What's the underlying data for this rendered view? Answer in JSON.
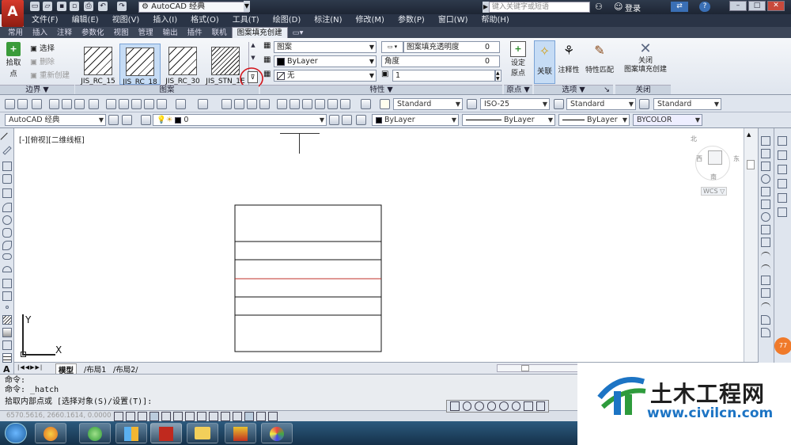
{
  "app": {
    "logo_letter": "A",
    "workspace": "AutoCAD 经典",
    "doc_title": "",
    "search_placeholder": "键入关键字或短语",
    "login": "登录"
  },
  "menubar": {
    "items": [
      "文件(F)",
      "编辑(E)",
      "视图(V)",
      "插入(I)",
      "格式(O)",
      "工具(T)",
      "绘图(D)",
      "标注(N)",
      "修改(M)",
      "参数(P)",
      "窗口(W)",
      "帮助(H)"
    ]
  },
  "ribbon_tabs": {
    "items": [
      "常用",
      "插入",
      "注释",
      "参数化",
      "视图",
      "管理",
      "输出",
      "插件",
      "联机",
      "图案填充创建"
    ],
    "active_index": 9
  },
  "ribbon": {
    "boundary": {
      "pick_label": "拾取点",
      "select_label": "选择",
      "remove_label": "删除",
      "recreate_label": "重新创建",
      "panel_title": "边界 ▼"
    },
    "pattern": {
      "items": [
        "JIS_RC_15",
        "JIS_RC_18",
        "JIS_RC_30",
        "JIS_STN_1E"
      ],
      "selected_index": 1,
      "panel_title": "图案"
    },
    "properties": {
      "type_value": "图案",
      "color_value": "ByLayer",
      "bg_value": "无",
      "transparency_label": "图案填充透明度",
      "transparency_value": "0",
      "angle_label": "角度",
      "angle_value": "0",
      "scale_value": "1",
      "panel_title": "特性 ▼"
    },
    "origin": {
      "set_origin_label": "设定\n原点",
      "panel_title": "原点 ▼"
    },
    "options": {
      "associative_label": "关联",
      "annotative_label": "注释性",
      "match_label": "特性匹配",
      "panel_title": "选项 ▼",
      "panel_arrow": "↘"
    },
    "close": {
      "close_label": "关闭\n图案填充创建",
      "panel_title": "关闭"
    }
  },
  "toolbar1": {
    "text_style": "Standard",
    "dim_style": "ISO-25",
    "table_style": "Standard",
    "mleader_style": "Standard"
  },
  "toolbar2": {
    "workspace": "AutoCAD 经典",
    "layer": "0",
    "color": "ByLayer",
    "linetype": "ByLayer",
    "lineweight": "ByLayer",
    "plotstyle": "BYCOLOR"
  },
  "viewport": {
    "label": "[-][俯视][二维线框]",
    "compass_n": "北",
    "compass_s": "南",
    "compass_w": "西",
    "compass_e": "东",
    "wcs": "WCS ▽",
    "axis_x": "X",
    "axis_y": "Y"
  },
  "layout_tabs": {
    "items": [
      "模型",
      "布局1",
      "布局2"
    ],
    "active_index": 0
  },
  "command": {
    "lines": [
      "命令:",
      "命令:  _hatch",
      "拾取内部点或 [选择对象(S)/设置(T)]:"
    ]
  },
  "status": {
    "coords": "6570.5616, 2660.1614, 0.0000"
  },
  "watermark": {
    "brand": "土木工程网",
    "url": "www.civilcn.com"
  },
  "badge": {
    "text": "77"
  }
}
